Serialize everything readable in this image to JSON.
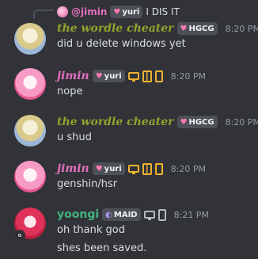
{
  "reply": {
    "username": "@jimin",
    "tag": "yuri",
    "text": "I DIS IT"
  },
  "messages": [
    {
      "username": "the wordle cheater",
      "tag": "HGCG",
      "time": "8:20 PM",
      "lines": [
        "did u delete windows yet"
      ]
    },
    {
      "username": "jimin",
      "tag": "yuri",
      "time": "8:20 PM",
      "lines": [
        "nope"
      ]
    },
    {
      "username": "the wordle cheater",
      "tag": "HGCG",
      "time": "8:20 PM",
      "lines": [
        "u shud"
      ]
    },
    {
      "username": "jimin",
      "tag": "yuri",
      "time": "8:20 PM",
      "lines": [
        "genshin/hsr"
      ]
    },
    {
      "username": "yoongi",
      "tag": "MAID",
      "time": "8:21 PM",
      "lines": [
        "oh thank god",
        "shes been saved."
      ]
    }
  ],
  "colors": {
    "background": "#313338",
    "wordle_name": "#95a12d",
    "jimin_name": "#e46fc0",
    "yoongi_name": "#43b581",
    "timestamp": "#949ba4",
    "tag_bg": "#4e5058"
  }
}
